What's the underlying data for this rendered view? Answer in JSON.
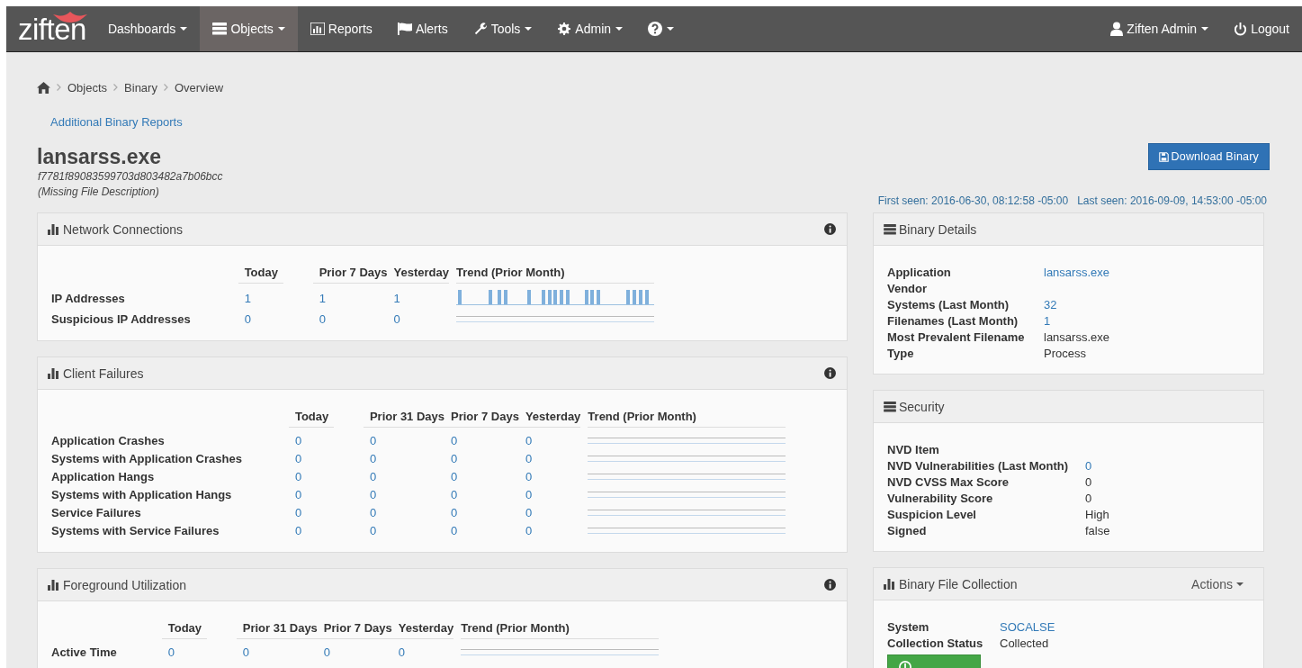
{
  "navbar": {
    "logo": "ziften",
    "items": [
      {
        "label": "Dashboards",
        "caret": true,
        "selected": false
      },
      {
        "label": "Objects",
        "caret": true,
        "selected": true
      },
      {
        "label": "Reports",
        "caret": false,
        "selected": false
      },
      {
        "label": "Alerts",
        "caret": false,
        "selected": false
      },
      {
        "label": "Tools",
        "caret": true,
        "selected": false
      },
      {
        "label": "Admin",
        "caret": true,
        "selected": false
      },
      {
        "caret": true,
        "selected": false
      }
    ],
    "user": {
      "label": "Ziften Admin"
    },
    "logout": {
      "label": "Logout"
    }
  },
  "breadcrumb": [
    "Objects",
    "Binary",
    "Overview"
  ],
  "reports_link": "Additional Binary Reports",
  "binary": {
    "name": "lansarss.exe",
    "hash": "f7781f89083599703d803482a7b06bcc",
    "description": "(Missing File Description)"
  },
  "download_button": "Download Binary",
  "seen": [
    "First seen: 2016-06-30, 08:12:58 -05:00",
    "Last seen: 2016-09-09, 14:53:00 -05:00"
  ],
  "left_panels": [
    {
      "title": "Network Connections",
      "columns": [
        "Today",
        "Prior 7 Days",
        "Yesterday",
        "Trend (Prior Month)"
      ],
      "rows": [
        {
          "label": "IP Addresses",
          "values": [
            "1",
            "1",
            "1"
          ],
          "kind": "bars"
        },
        {
          "label": "Suspicious IP Addresses",
          "values": [
            "0",
            "0",
            "0"
          ],
          "kind": "flat"
        }
      ]
    },
    {
      "title": "Client Failures",
      "columns": [
        "Today",
        "Prior 31 Days",
        "Prior 7 Days",
        "Yesterday",
        "Trend (Prior Month)"
      ],
      "rows": [
        {
          "label": "Application Crashes",
          "values": [
            "0",
            "0",
            "0",
            "0"
          ],
          "kind": "flat"
        },
        {
          "label": "Systems with Application Crashes",
          "values": [
            "0",
            "0",
            "0",
            "0"
          ],
          "kind": "flat"
        },
        {
          "label": "Application Hangs",
          "values": [
            "0",
            "0",
            "0",
            "0"
          ],
          "kind": "flat"
        },
        {
          "label": "Systems with Application Hangs",
          "values": [
            "0",
            "0",
            "0",
            "0"
          ],
          "kind": "flat"
        },
        {
          "label": "Service Failures",
          "values": [
            "0",
            "0",
            "0",
            "0"
          ],
          "kind": "flat"
        },
        {
          "label": "Systems with Service Failures",
          "values": [
            "0",
            "0",
            "0",
            "0"
          ],
          "kind": "flat"
        }
      ]
    },
    {
      "title": "Foreground Utilization",
      "columns": [
        "Today",
        "Prior 31 Days",
        "Prior 7 Days",
        "Yesterday",
        "Trend (Prior Month)"
      ],
      "rows": [
        {
          "label": "Active Time",
          "values": [
            "0",
            "0",
            "0",
            "0"
          ],
          "kind": "flat"
        }
      ]
    }
  ],
  "right_panels": [
    {
      "title": "Binary Details",
      "rows": [
        {
          "label": "Application",
          "value": "lansarss.exe",
          "link": true
        },
        {
          "label": "Vendor"
        },
        {
          "label": "Systems (Last Month)",
          "value": "32",
          "link": true
        },
        {
          "label": "Filenames (Last Month)",
          "value": "1",
          "link": true
        },
        {
          "label": "Most Prevalent Filename",
          "value": "lansarss.exe",
          "link": false
        },
        {
          "label": "Type",
          "value": "Process",
          "link": false
        }
      ]
    },
    {
      "title": "Security",
      "rows": [
        {
          "label": "NVD Item"
        },
        {
          "label": "NVD Vulnerabilities (Last Month)",
          "value": "0",
          "link": true
        },
        {
          "label": "NVD CVSS Max Score",
          "value": "0",
          "link": false
        },
        {
          "label": "Vulnerability Score",
          "value": "0",
          "link": false
        },
        {
          "label": "Suspicion Level",
          "value": "High",
          "link": false
        },
        {
          "label": "Signed",
          "value": "false",
          "link": false
        }
      ]
    },
    {
      "title": "Binary File Collection",
      "actions": "Actions",
      "rows": [
        {
          "label": "System",
          "value": "SOCALSE",
          "link": true
        },
        {
          "label": "Collection Status",
          "value": "Collected",
          "link": false
        }
      ],
      "button": true
    }
  ]
}
